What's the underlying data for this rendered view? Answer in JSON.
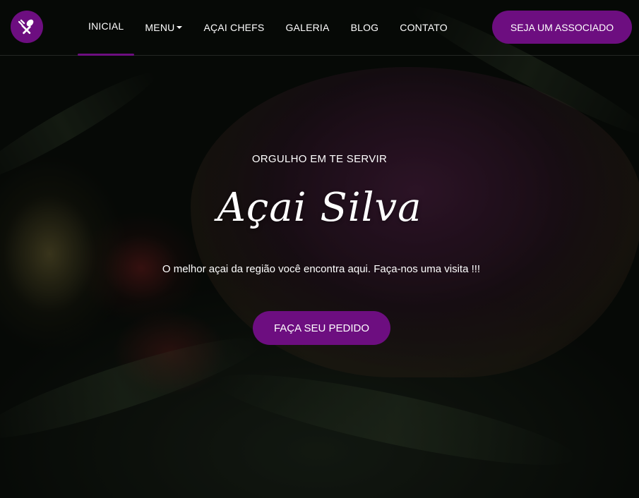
{
  "theme": {
    "accent": "#6d0e80",
    "text": "#ffffff"
  },
  "brand": {
    "logo_icon": "utensils-icon"
  },
  "nav": {
    "items": [
      {
        "label": "INICIAL",
        "active": true
      },
      {
        "label": "MENU",
        "has_dropdown": true
      },
      {
        "label": "AÇAI CHEFS"
      },
      {
        "label": "GALERIA"
      },
      {
        "label": "BLOG"
      },
      {
        "label": "CONTATO"
      }
    ],
    "cta_label": "SEJA UM ASSOCIADO"
  },
  "hero": {
    "eyebrow": "ORGULHO EM TE SERVIR",
    "title": "Açai Silva",
    "subtitle": "O melhor açai da região você encontra aqui. Faça-nos uma visita !!!",
    "cta_label": "FAÇA SEU PEDIDO"
  }
}
